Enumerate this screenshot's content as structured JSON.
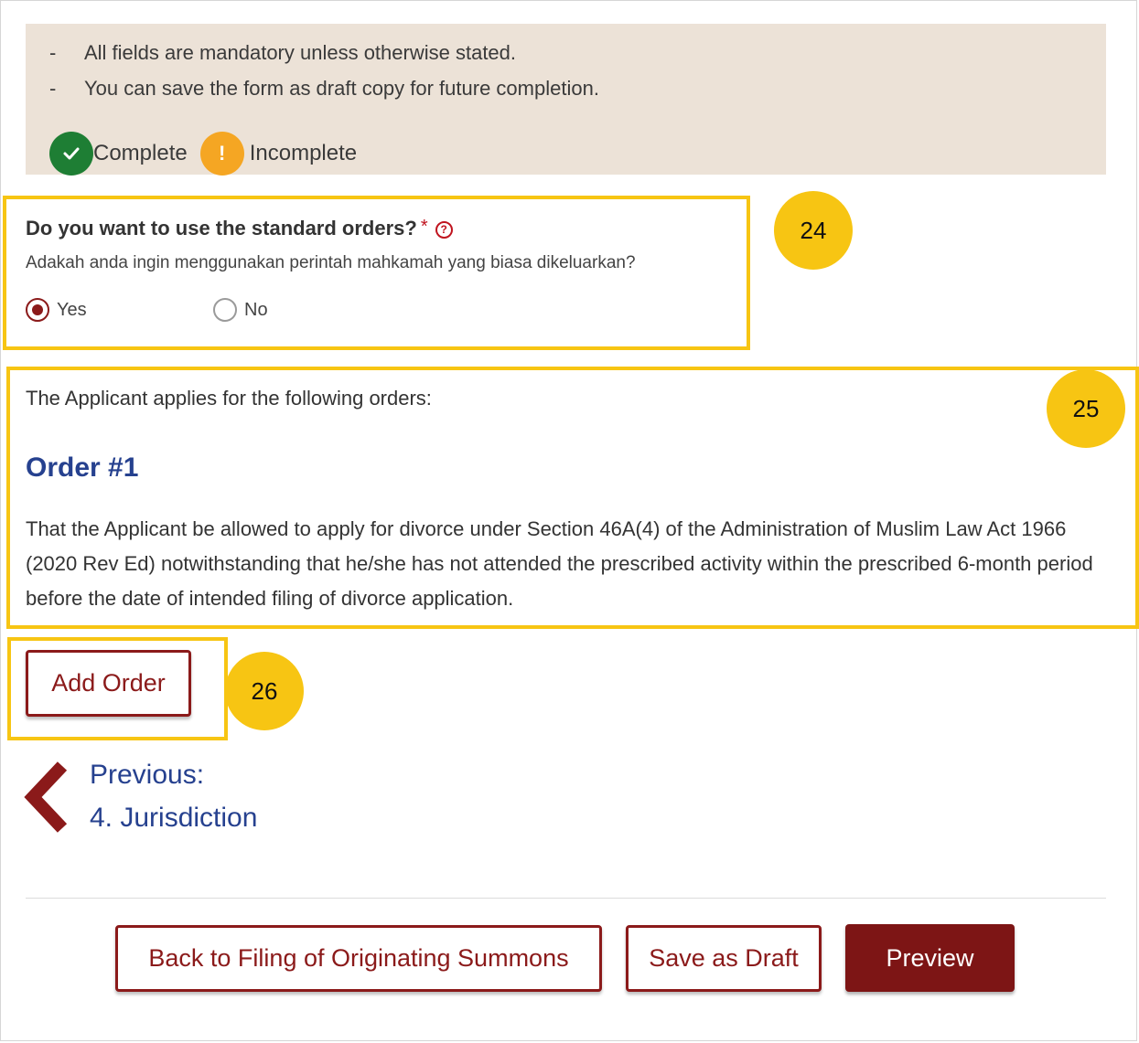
{
  "info": {
    "dash": "-",
    "notes": [
      "All fields are mandatory unless otherwise stated.",
      "You can save the form as draft copy for future completion."
    ],
    "legend_complete": "Complete",
    "legend_incomplete": "Incomplete",
    "incomplete_glyph": "!"
  },
  "question": {
    "title": "Do you want to use the standard orders?",
    "required_mark": "*",
    "help_glyph": "?",
    "subtitle": "Adakah anda ingin menggunakan perintah mahkamah yang biasa dikeluarkan?",
    "options": [
      "Yes",
      "No"
    ],
    "selected": "Yes"
  },
  "orders": {
    "intro": "The Applicant applies for the following orders:",
    "items": [
      {
        "heading": "Order #1",
        "text": "That the Applicant be allowed to apply for divorce under Section 46A(4) of the Administration of Muslim Law Act 1966 (2020 Rev Ed) notwithstanding that he/she has not attended the prescribed activity within the prescribed 6-month period before the date of intended filing of divorce application."
      }
    ],
    "add_label": "Add Order"
  },
  "callouts": [
    "24",
    "25",
    "26"
  ],
  "nav": {
    "prev_label": "Previous:",
    "prev_target": "4. Jurisdiction"
  },
  "footer": {
    "back_label": "Back to Filing of Originating Summons",
    "draft_label": "Save as Draft",
    "preview_label": "Preview"
  },
  "colors": {
    "brand_red": "#8b1a1a",
    "link_blue": "#26418f",
    "callout_yellow": "#f7c513",
    "complete_green": "#1e7e34",
    "incomplete_orange": "#f5a623",
    "info_panel_bg": "#ece2d7"
  }
}
